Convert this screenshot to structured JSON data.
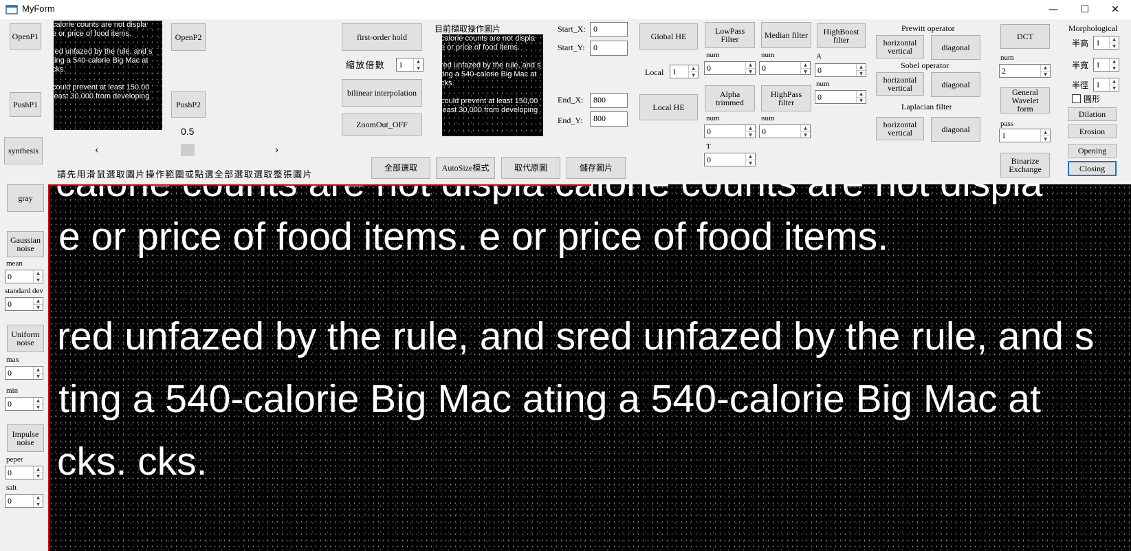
{
  "window": {
    "title": "MyForm",
    "minimize": "—",
    "maximize": "☐",
    "close": "✕"
  },
  "left_panel": {
    "open_p1": "OpenP1",
    "push_p1": "PushP1",
    "synthesis": "synthesis",
    "gray": "gray",
    "gaussian_noise": "Gaussian\nnoise",
    "mean_label": "mean",
    "mean_value": "0",
    "std_label": "standard dev",
    "std_value": "0",
    "uniform_noise": "Uniform\nnoise",
    "max_label": "max",
    "max_value": "0",
    "min_label": "min",
    "min_value": "0",
    "impulse_noise": "Impulse\nnoise",
    "peper_label": "peper",
    "peper_value": "0",
    "salt_label": "salt",
    "salt_value": "0"
  },
  "thumbnails": {
    "lines": [
      "calorie counts are not displa",
      "e or price of food items.",
      "",
      "red unfazed by the rule, and s",
      "ting a 540-calorie Big Mac at",
      "cks.",
      "",
      "could prevent at least 150,00",
      "least 30,000 from developing"
    ]
  },
  "center": {
    "open_p2": "OpenP2",
    "push_p2": "PushP2",
    "scroll_value": "0.5",
    "scroll_left": "‹",
    "scroll_right": "›",
    "hint": "請先用滑鼠選取圖片操作範圍或點選全部選取選取整張圖片",
    "first_order_hold": "first-order hold",
    "zoom_label": "縮放倍數",
    "zoom_value": "1",
    "bilinear": "bilinear interpolation",
    "zoomout": "ZoomOut_OFF",
    "current_image_label": "目前擷取操作圖片",
    "select_all": "全部選取",
    "autosize": "AutoSize模式",
    "replace_original": "取代原圖",
    "save_image": "儲存圖片"
  },
  "coords": {
    "start_x_label": "Start_X:",
    "start_x": "0",
    "start_y_label": "Start_Y:",
    "start_y": "0",
    "end_x_label": "End_X:",
    "end_x": "800",
    "end_y_label": "End_Y:",
    "end_y": "800"
  },
  "filters": {
    "global_he": "Global HE",
    "local_label": "Local",
    "local_value": "1",
    "local_he": "Local HE",
    "lowpass": "LowPass\nFilter",
    "lowpass_num_label": "num",
    "lowpass_num": "0",
    "median": "Median filter",
    "median_num_label": "num",
    "median_num": "0",
    "highboost": "HighBoost\nfilter",
    "a_label": "A",
    "a_value": "0",
    "hb_num_label": "num",
    "hb_num": "0",
    "alpha_trimmed": "Alpha\ntrimmed",
    "alpha_num_label": "num",
    "alpha_num": "0",
    "t_label": "T",
    "t_value": "0",
    "highpass": "HighPass\nfilter",
    "hp_num_label": "num",
    "hp_num": "0"
  },
  "operators": {
    "prewitt_label": "Prewitt operator",
    "prewitt_hv": "horizontal\nvertical",
    "prewitt_diag": "diagonal",
    "sobel_label": "Sobel operator",
    "sobel_hv": "horizontal\nvertical",
    "sobel_diag": "diagonal",
    "laplacian_label": "Laplacian filter",
    "laplacian_hv": "horizontal\nvertical",
    "laplacian_diag": "diagonal"
  },
  "transforms": {
    "dct": "DCT",
    "num_label": "num",
    "num_value": "2",
    "wavelet": "General\nWavelet\nform",
    "pass_label": "pass",
    "pass_value": "1",
    "binarize": "Binarize\nExchange"
  },
  "morphological": {
    "title": "Morphological",
    "height_label": "半高",
    "height_value": "1",
    "width_label": "半寬",
    "width_value": "1",
    "radius_label": "半徑",
    "radius_value": "1",
    "circle_label": "圓形",
    "dilation": "Dilation",
    "erosion": "Erosion",
    "opening": "Opening",
    "closing": "Closing"
  },
  "main_image": {
    "lines": [
      "calorie counts are not displa calorie counts are not displa",
      "e or price of food items.          e or price of food items.",
      "",
      "red unfazed by the rule, and sred unfazed by the rule, and s",
      "ting a 540-calorie Big Mac ating a 540-calorie Big Mac at",
      "cks.                                         cks."
    ]
  }
}
